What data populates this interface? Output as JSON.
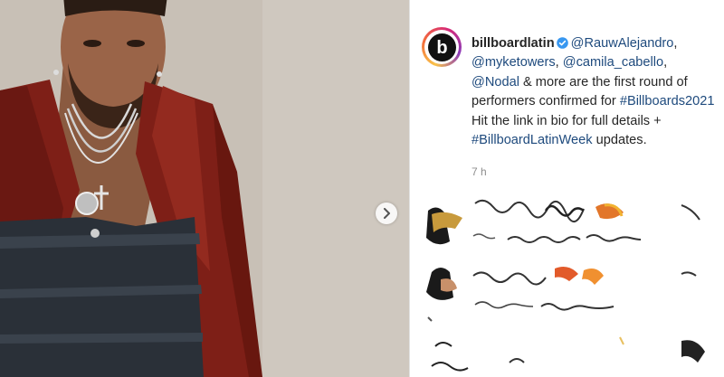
{
  "post": {
    "username": "billboardlatin",
    "mention_1": "@RauwAlejandro",
    "sep_1": ",",
    "mention_2": "@myketowers",
    "sep_2": ",",
    "mention_3": "@camila_cabello",
    "sep_3": ",",
    "mention_4": "@Nodal",
    "text_1": "& more are the first round of performers confirmed for",
    "hashtag_1": "#Billboards2021",
    "text_2": "Hit the link in bio for full details +",
    "hashtag_2": "#BillboardLatinWeek",
    "text_3": "updates.",
    "time": "7 h"
  },
  "avatar": {
    "logo_letter": "b"
  },
  "icons": {
    "next": "chevron-right-icon",
    "verified": "verified-badge-icon"
  },
  "colors": {
    "link": "#1e4a7d",
    "verified": "#3897f0",
    "jacket": "#7e1f17",
    "denim": "#2a3038"
  }
}
